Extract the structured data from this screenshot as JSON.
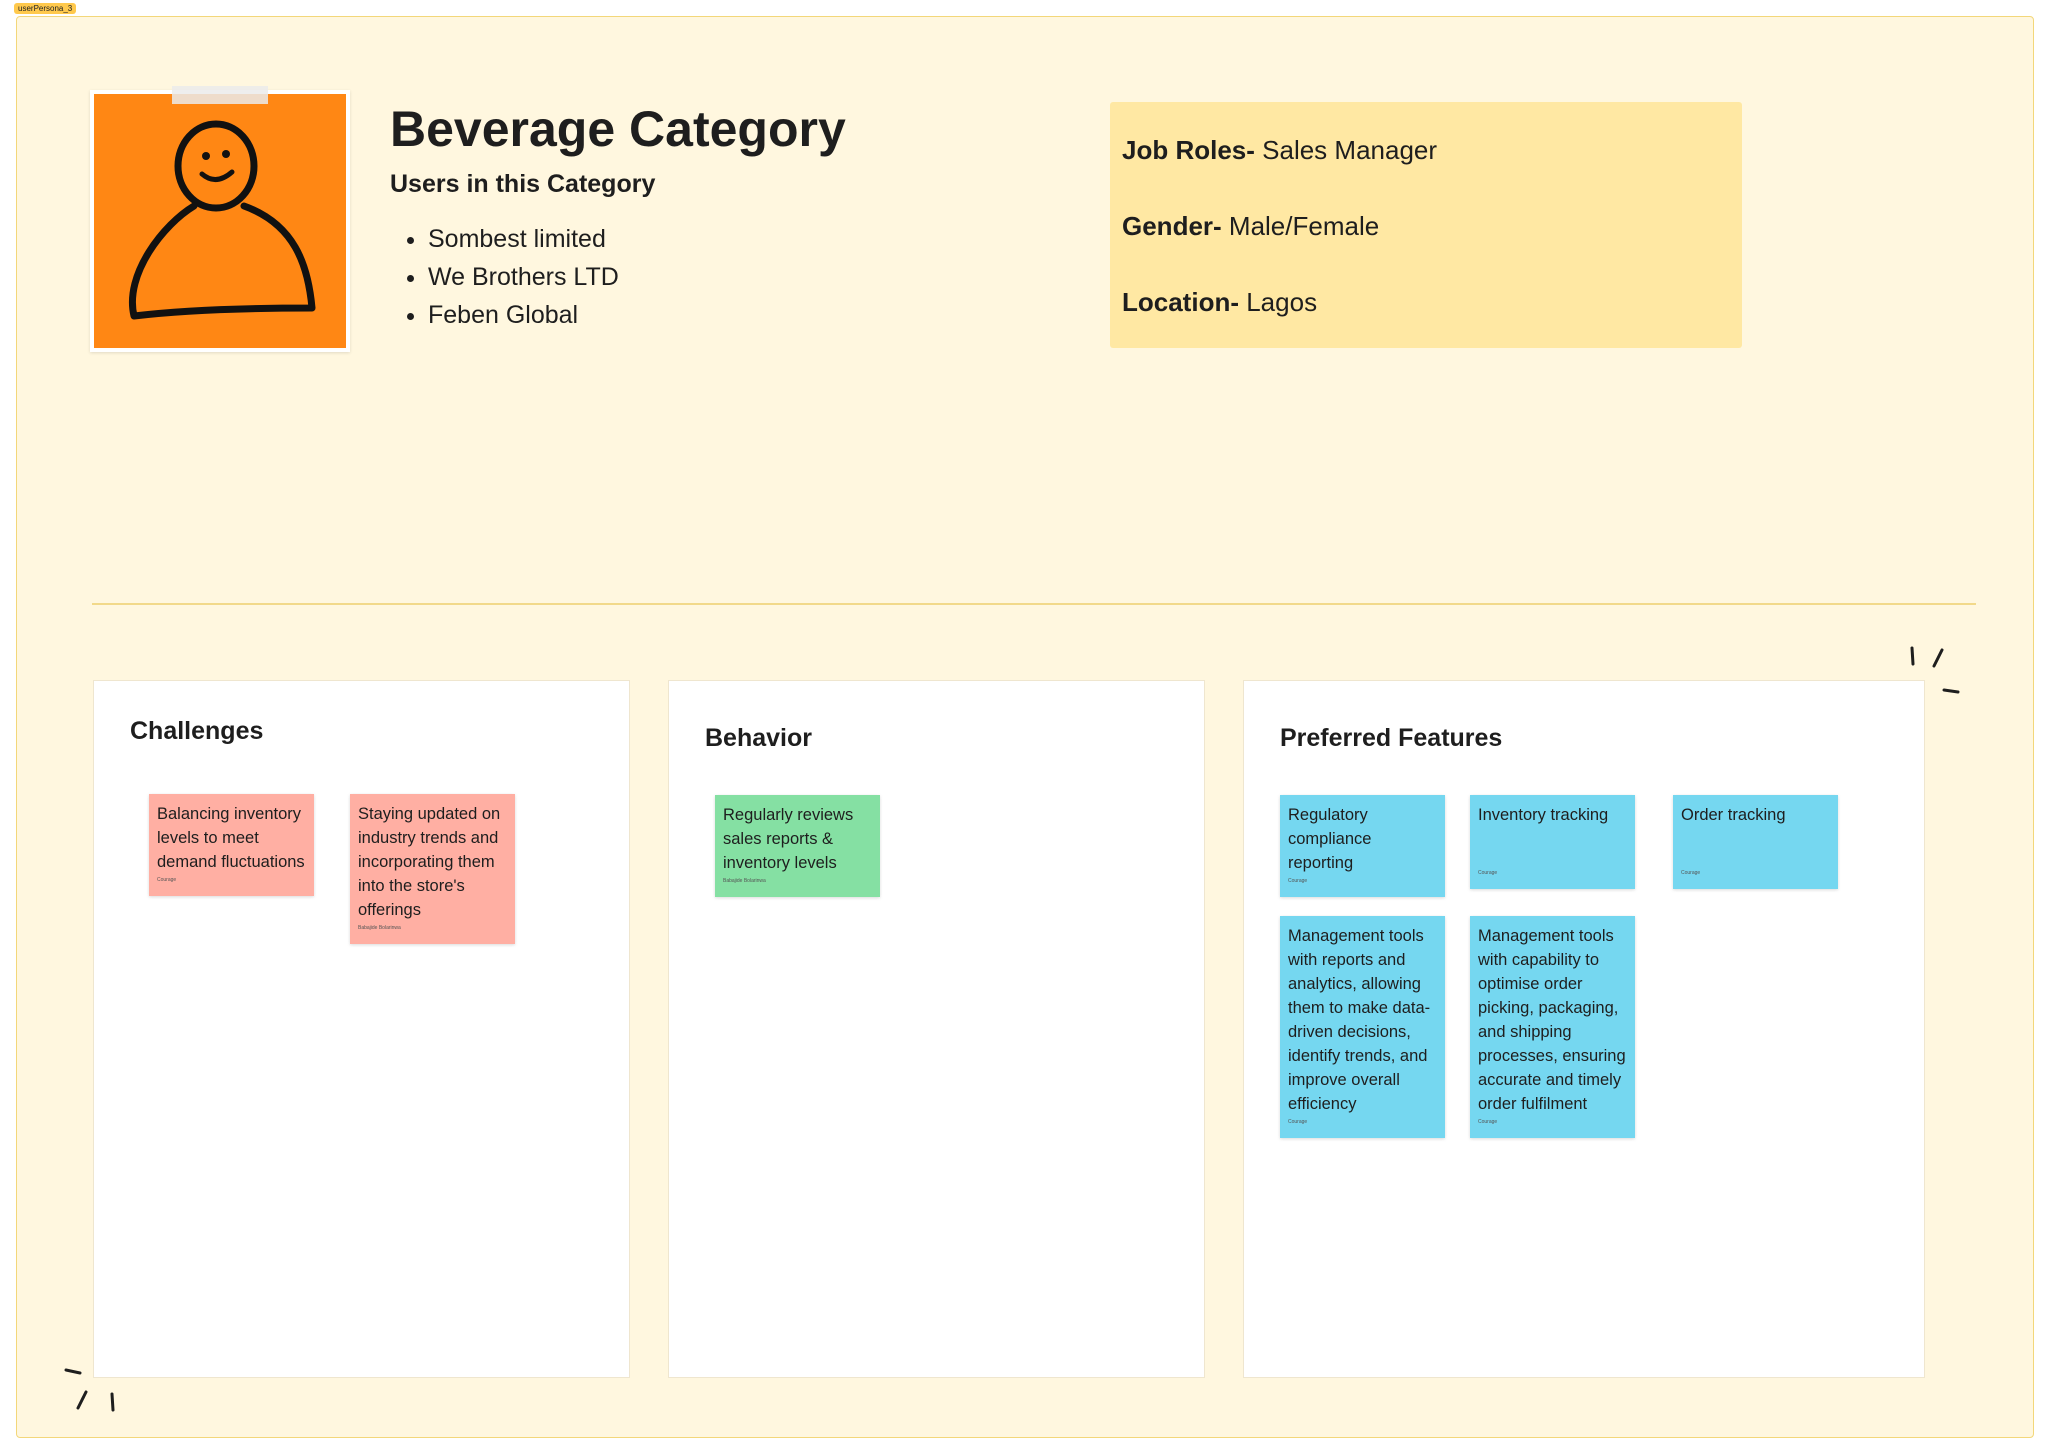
{
  "frame": {
    "label": "userPersona_3"
  },
  "header": {
    "title": "Beverage Category",
    "subtitle": "Users in this Category",
    "users": [
      "Sombest limited",
      "We Brothers LTD",
      "Feben Global"
    ]
  },
  "info": {
    "job_roles_label": "Job Roles-",
    "job_roles_value": " Sales Manager",
    "gender_label": "Gender-",
    "gender_value": " Male/Female",
    "location_label": "Location-",
    "location_value": " Lagos"
  },
  "panels": {
    "challenges": {
      "title": "Challenges",
      "notes": [
        {
          "text": "Balancing inventory levels to meet demand fluctuations",
          "author": "Courage"
        },
        {
          "text": "Staying updated on industry trends and incorporating them into the store's offerings",
          "author": "Babajide Bolarinwa"
        }
      ]
    },
    "behavior": {
      "title": "Behavior",
      "notes": [
        {
          "text": "Regularly reviews sales reports & inventory levels",
          "author": "Babajide Bolarinwa"
        }
      ]
    },
    "features": {
      "title": "Preferred Features",
      "notes": [
        {
          "text": "Regulatory compliance reporting",
          "author": "Courage"
        },
        {
          "text": "Inventory tracking",
          "author": "Courage"
        },
        {
          "text": "Order tracking",
          "author": "Courage"
        },
        {
          "text": "Management tools with reports and analytics, allowing them to make data-driven decisions, identify trends, and improve overall efficiency",
          "author": "Courage"
        },
        {
          "text": "Management tools with capability to optimise order picking, packaging, and shipping processes, ensuring accurate and timely order fulfilment",
          "author": "Courage"
        }
      ]
    }
  },
  "colors": {
    "frame_bg": "#fff7df",
    "avatar_orange": "#ff8714",
    "info_bg": "#ffe8a3",
    "sticky_pink": "#ffafa3",
    "sticky_green": "#85e0a3",
    "sticky_blue": "#75d7f0"
  },
  "icons": {
    "avatar": "person-doodle-icon"
  }
}
